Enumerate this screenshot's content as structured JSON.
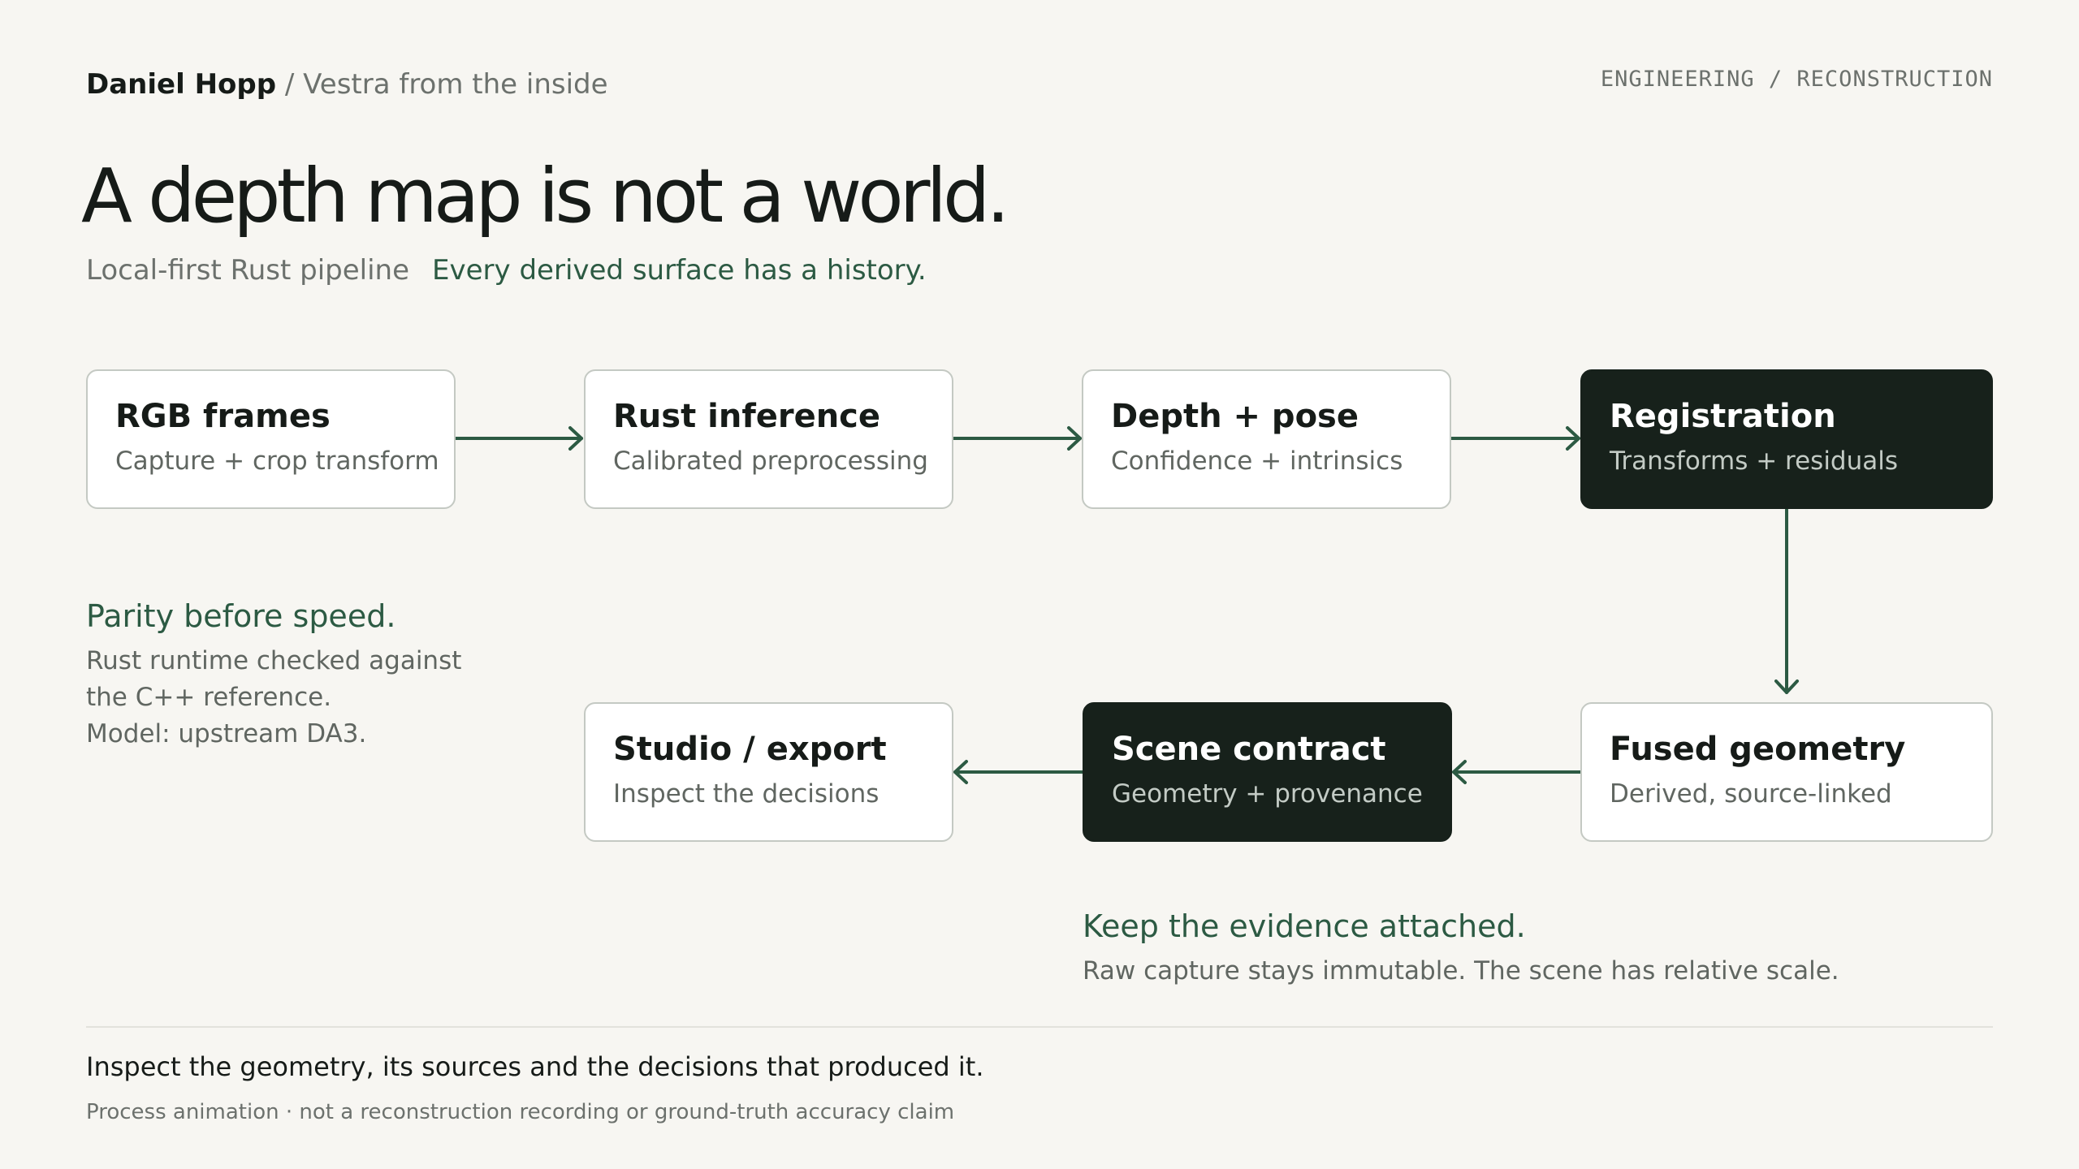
{
  "header": {
    "author": "Daniel Hopp",
    "separator": " / ",
    "subtitle": "Vestra from the inside",
    "section_tag": "ENGINEERING / RECONSTRUCTION"
  },
  "headline": "A depth map is not a world.",
  "tagline": {
    "lead": "Local-first Rust pipeline",
    "accent": "Every derived surface has a history."
  },
  "pipeline": {
    "nodes": [
      {
        "id": "rgb-frames",
        "title": "RGB frames",
        "subtitle": "Capture + crop transform",
        "highlighted": false
      },
      {
        "id": "rust-inference",
        "title": "Rust inference",
        "subtitle": "Calibrated preprocessing",
        "highlighted": false
      },
      {
        "id": "depth-pose",
        "title": "Depth + pose",
        "subtitle": "Confidence + intrinsics",
        "highlighted": false
      },
      {
        "id": "registration",
        "title": "Registration",
        "subtitle": "Transforms + residuals",
        "highlighted": true
      },
      {
        "id": "fused-geometry",
        "title": "Fused geometry",
        "subtitle": "Derived, source-linked",
        "highlighted": false
      },
      {
        "id": "scene-contract",
        "title": "Scene contract",
        "subtitle": "Geometry + provenance",
        "highlighted": true
      },
      {
        "id": "studio-export",
        "title": "Studio / export",
        "subtitle": "Inspect the decisions",
        "highlighted": false
      }
    ],
    "edges": [
      {
        "from": "rgb-frames",
        "to": "rust-inference"
      },
      {
        "from": "rust-inference",
        "to": "depth-pose"
      },
      {
        "from": "depth-pose",
        "to": "registration"
      },
      {
        "from": "registration",
        "to": "fused-geometry"
      },
      {
        "from": "fused-geometry",
        "to": "scene-contract"
      },
      {
        "from": "scene-contract",
        "to": "studio-export"
      }
    ]
  },
  "notes": {
    "parity": {
      "title": "Parity before speed.",
      "lines": [
        "Rust runtime checked against",
        "the C++ reference.",
        "Model: upstream DA3."
      ]
    },
    "evidence": {
      "title": "Keep the evidence attached.",
      "body": "Raw capture stays immutable. The scene has relative scale."
    }
  },
  "footer": {
    "statement": "Inspect the geometry, its sources and the decisions that produced it.",
    "disclaimer": "Process animation · not a reconstruction recording or ground-truth accuracy claim"
  },
  "colors": {
    "background": "#f7f6f2",
    "ink": "#161b18",
    "muted": "#6c716d",
    "accent": "#2c5a43",
    "dark_node": "#17211b",
    "node_border": "#c4c9c3"
  }
}
